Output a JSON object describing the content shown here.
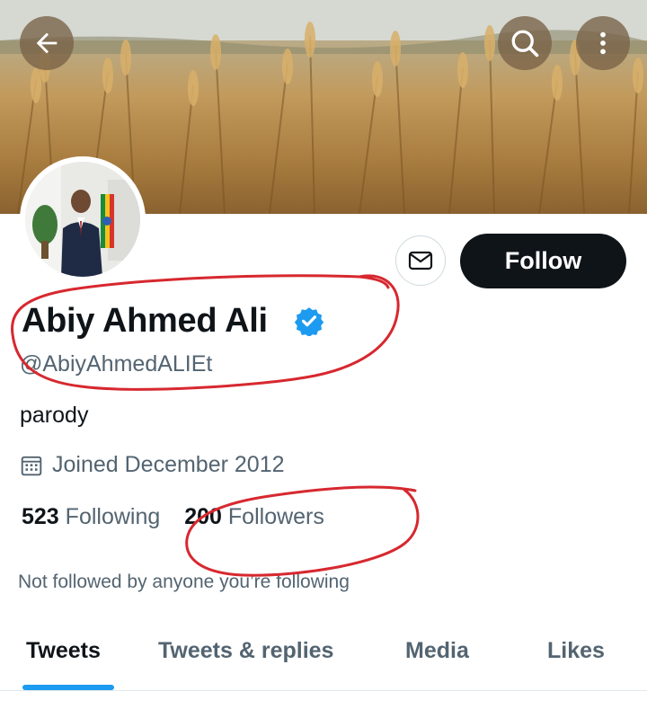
{
  "header": {
    "banner_icon": "wheat-field-banner",
    "back_icon": "arrow-left-icon",
    "search_icon": "search-icon",
    "more_icon": "more-vertical-icon"
  },
  "profile": {
    "avatar_icon": "profile-photo",
    "name": "Abiy Ahmed Ali",
    "verified_icon": "verified-badge-icon",
    "handle": "@AbiyAhmedALIEt",
    "bio": "parody",
    "joined": "Joined December 2012",
    "following_count": "523",
    "following_label": "Following",
    "followers_count": "200",
    "followers_label": "Followers",
    "not_followed_text": "Not followed by anyone you’re following"
  },
  "actions": {
    "message_icon": "envelope-icon",
    "follow_label": "Follow"
  },
  "tabs": [
    {
      "label": "Tweets",
      "active": true
    },
    {
      "label": "Tweets & replies",
      "active": false
    },
    {
      "label": "Media",
      "active": false
    },
    {
      "label": "Likes",
      "active": false
    }
  ],
  "colors": {
    "accent": "#1d9bf0",
    "text": "#0f1419",
    "secondary_text": "#536471",
    "follow_button": "#0f1419",
    "annotation_red": "#d7282f"
  }
}
